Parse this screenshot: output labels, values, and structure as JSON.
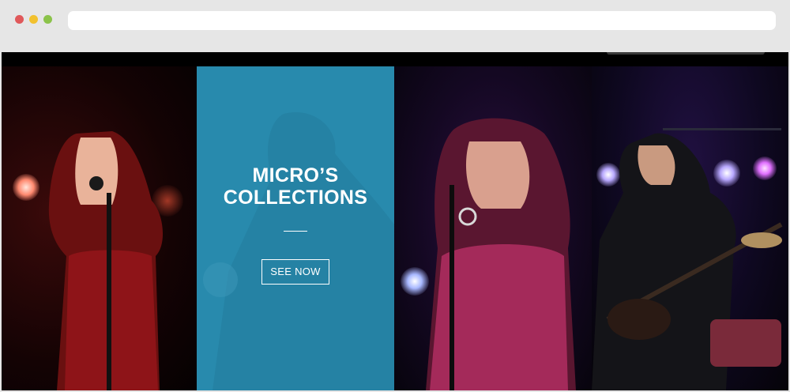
{
  "browser": {
    "window_controls": [
      "close",
      "minimize",
      "maximize"
    ],
    "url": ""
  },
  "hero": {
    "title_line1": "MICRO’S",
    "title_line2": "COLLECTIONS",
    "button_label": "SEE NOW",
    "accent_color": "#2a86a6"
  },
  "panels": [
    {
      "subject": "woman-singer-red-dress"
    },
    {
      "subject": "collection-overlay"
    },
    {
      "subject": "woman-singer-purple-light"
    },
    {
      "subject": "guitarist-stage-lights"
    }
  ]
}
